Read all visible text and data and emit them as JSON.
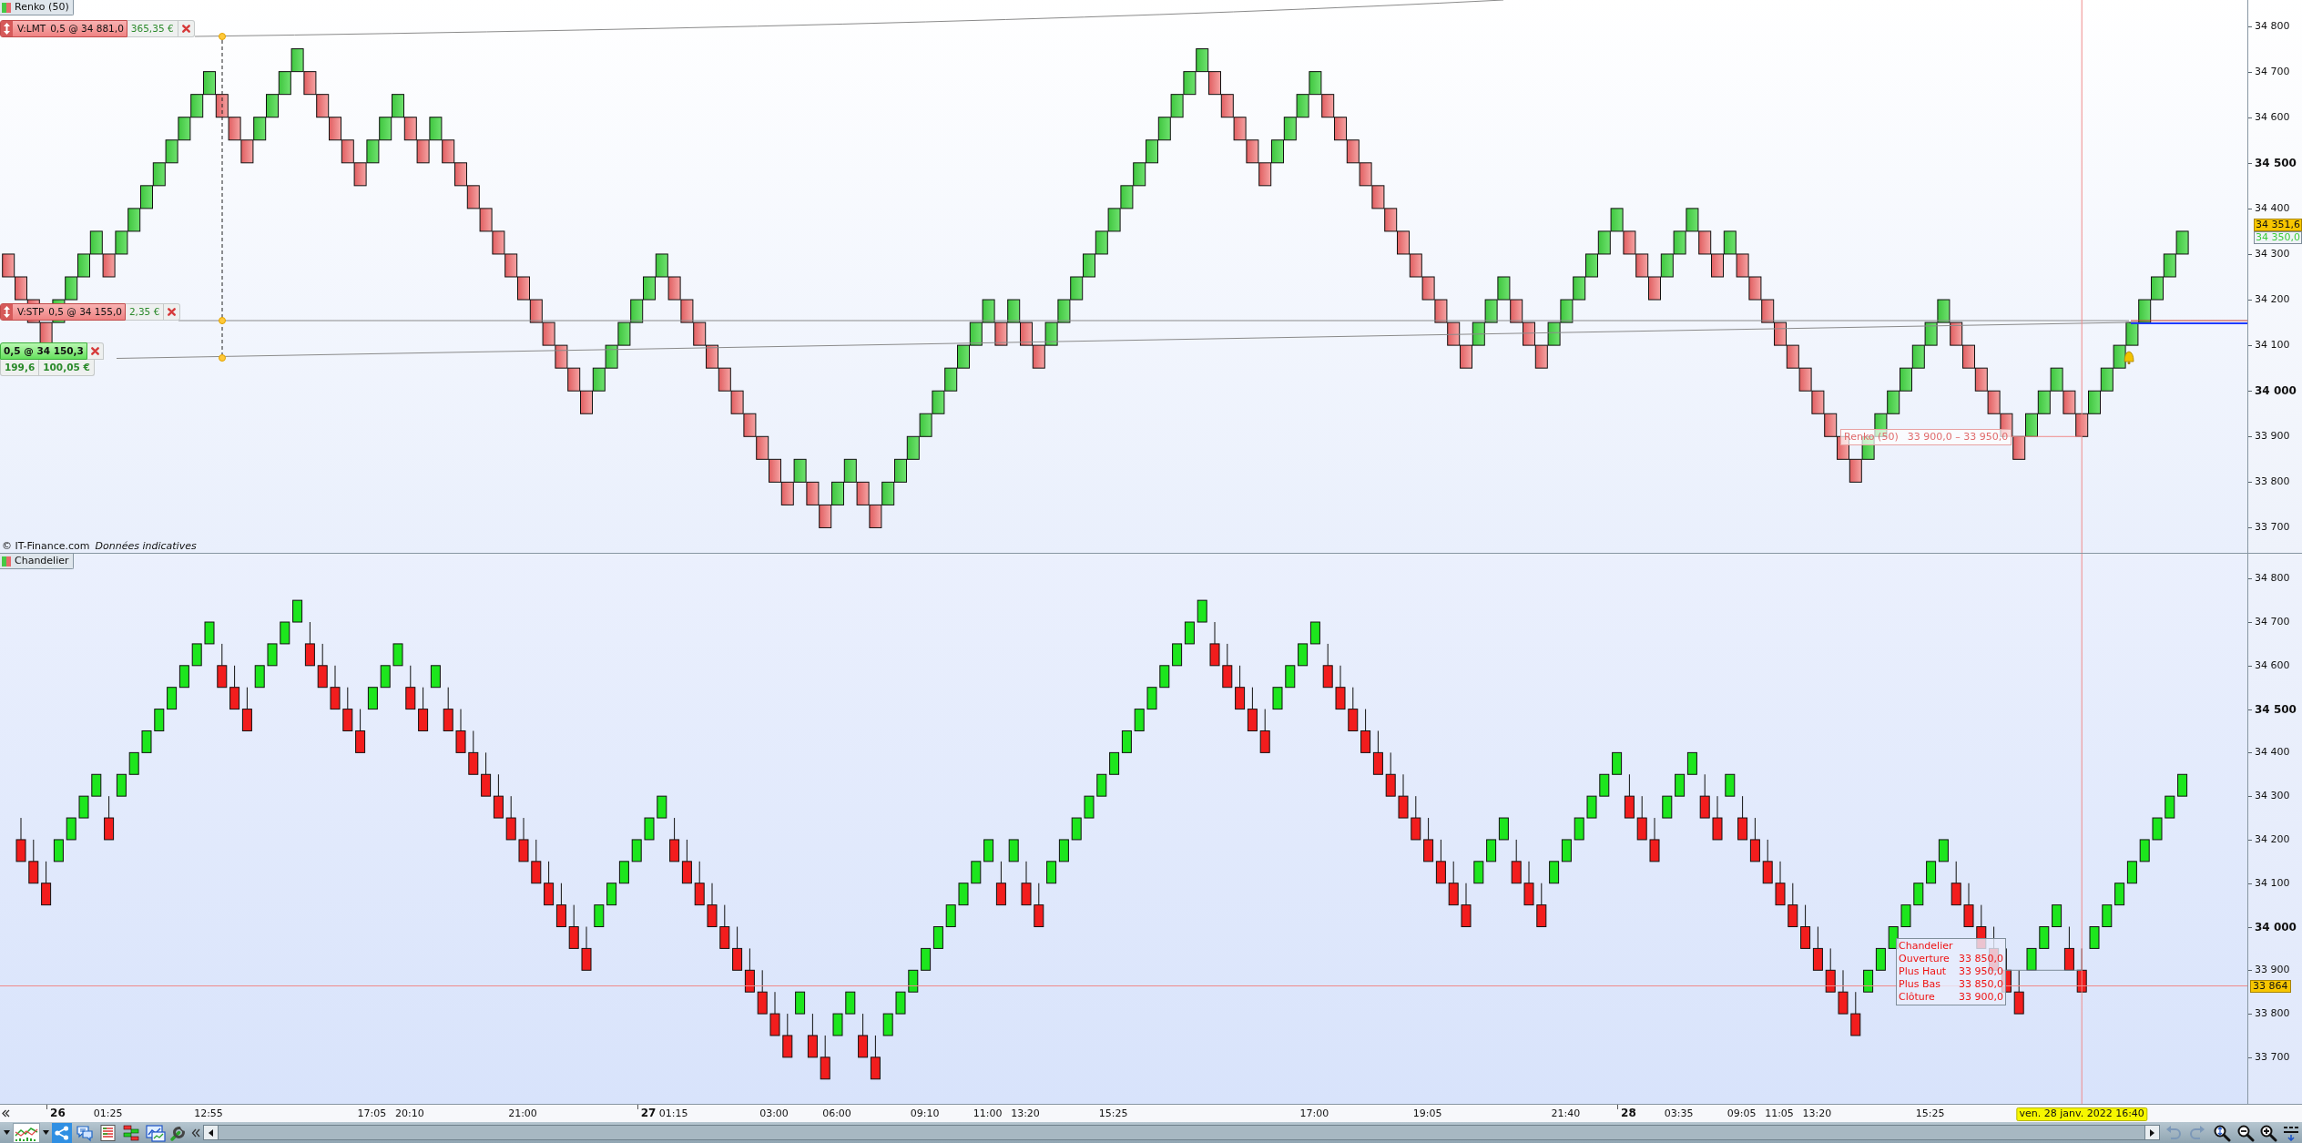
{
  "top_pane": {
    "legend": "Renko (50)",
    "orders": [
      {
        "type": "V:LMT",
        "detail": "0,5 @ 34 881,0",
        "profit": "365,35 €"
      },
      {
        "type": "V:STP",
        "detail": "0,5 @ 34 155,0",
        "profit": "2,35 €"
      }
    ],
    "position": {
      "detail": "0,5 @ 34 150,3",
      "points": "199,6",
      "profit": "100,05 €"
    },
    "price_axis": [
      {
        "text": "34 800",
        "major": false
      },
      {
        "text": "34 700",
        "major": false
      },
      {
        "text": "34 600",
        "major": false
      },
      {
        "text": "34 500",
        "major": true
      },
      {
        "text": "34 400",
        "major": false
      },
      {
        "text": "34 300",
        "major": false
      },
      {
        "text": "34 200",
        "major": false
      },
      {
        "text": "34 100",
        "major": false
      },
      {
        "text": "34 000",
        "major": true
      },
      {
        "text": "33 900",
        "major": false
      },
      {
        "text": "33 800",
        "major": false
      },
      {
        "text": "33 700",
        "major": false
      }
    ],
    "price_labels": [
      {
        "kind": "last",
        "text": "34 351,6"
      },
      {
        "kind": "close",
        "text": "34 350,0"
      }
    ],
    "tooltip": {
      "title": "Renko (50)",
      "text": "33 900,0 – 33 950,0"
    },
    "credits": {
      "source": "© IT-Finance.com",
      "note": "Données indicatives"
    }
  },
  "bottom_pane": {
    "legend": "Chandelier",
    "price_axis": [
      {
        "text": "34 800",
        "major": false
      },
      {
        "text": "34 700",
        "major": false
      },
      {
        "text": "34 600",
        "major": false
      },
      {
        "text": "34 500",
        "major": true
      },
      {
        "text": "34 400",
        "major": false
      },
      {
        "text": "34 300",
        "major": false
      },
      {
        "text": "34 200",
        "major": false
      },
      {
        "text": "34 100",
        "major": false
      },
      {
        "text": "34 000",
        "major": true
      },
      {
        "text": "33 900",
        "major": false
      },
      {
        "text": "33 800",
        "major": false
      },
      {
        "text": "33 700",
        "major": false
      }
    ],
    "price_label": "33 864",
    "tooltip": {
      "title": "Chandelier",
      "rows": [
        {
          "label": "Ouverture",
          "value": "33 850,0"
        },
        {
          "label": "Plus Haut",
          "value": "33 950,0"
        },
        {
          "label": "Plus Bas",
          "value": "33 850,0"
        },
        {
          "label": "Clôture",
          "value": "33 900,0"
        }
      ]
    }
  },
  "time_axis": {
    "labels": [
      {
        "text": "26",
        "major": true
      },
      {
        "text": "01:25",
        "major": false
      },
      {
        "text": "12:55",
        "major": false
      },
      {
        "text": "17:05",
        "major": false
      },
      {
        "text": "20:10",
        "major": false
      },
      {
        "text": "21:00",
        "major": false
      },
      {
        "text": "27",
        "major": true
      },
      {
        "text": "01:15",
        "major": false
      },
      {
        "text": "03:00",
        "major": false
      },
      {
        "text": "06:00",
        "major": false
      },
      {
        "text": "09:10",
        "major": false
      },
      {
        "text": "11:00",
        "major": false
      },
      {
        "text": "13:20",
        "major": false
      },
      {
        "text": "15:25",
        "major": false
      },
      {
        "text": "17:00",
        "major": false
      },
      {
        "text": "19:05",
        "major": false
      },
      {
        "text": "21:40",
        "major": false
      },
      {
        "text": "28",
        "major": true
      },
      {
        "text": "03:35",
        "major": false
      },
      {
        "text": "09:05",
        "major": false
      },
      {
        "text": "11:05",
        "major": false
      },
      {
        "text": "13:20",
        "major": false
      },
      {
        "text": "15:25",
        "major": false
      }
    ],
    "date_label": "ven. 28 janv. 2022 16:40"
  }
}
